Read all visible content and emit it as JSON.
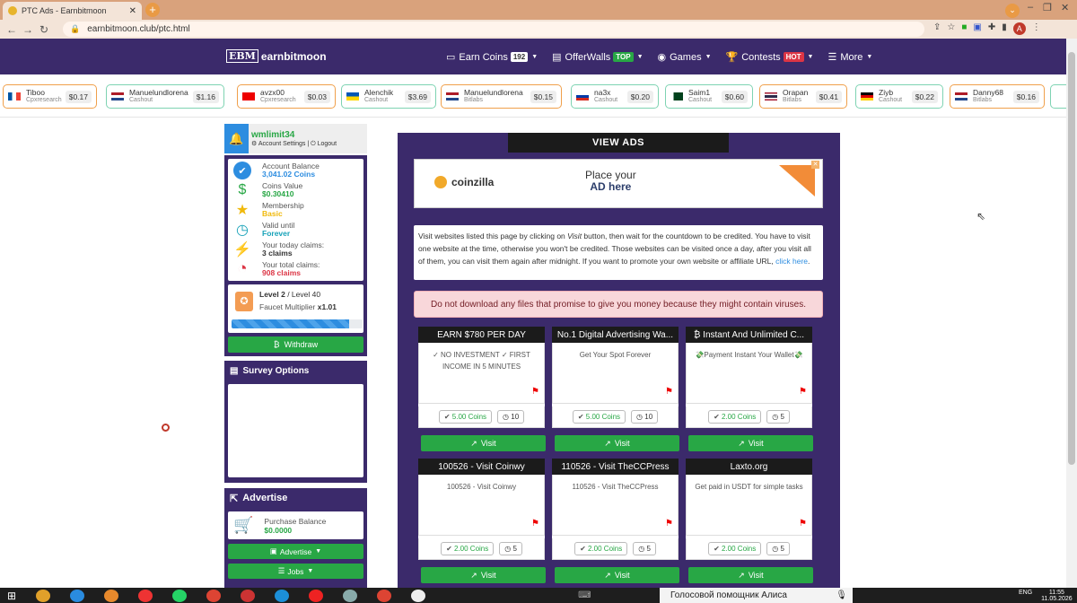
{
  "browser": {
    "tab_title": "PTC Ads - Earnbitmoon",
    "url": "earnbitmoon.club/ptc.html",
    "avatar_letter": "A"
  },
  "header": {
    "logo_mark": "EBM",
    "logo_text": "earnbitmoon",
    "nav": [
      {
        "label": "Earn Coins",
        "badge": "192"
      },
      {
        "label": "OfferWalls",
        "badge": "TOP"
      },
      {
        "label": "Games",
        "badge": ""
      },
      {
        "label": "Contests",
        "badge": "HOT"
      },
      {
        "label": "More",
        "badge": ""
      }
    ]
  },
  "ticker": [
    {
      "name": "Tiboo",
      "source": "Cpxresearch",
      "amount": "$0.17",
      "color": "#f0a04b",
      "flag": "fr"
    },
    {
      "name": "Manuelundlorena",
      "source": "Cashout",
      "amount": "$1.16",
      "color": "#7ed3b2",
      "flag": "nl"
    },
    {
      "name": "avzx00",
      "source": "Cpxresearch",
      "amount": "$0.03",
      "color": "#f0a04b",
      "flag": "yt"
    },
    {
      "name": "Alenchik",
      "source": "Cashout",
      "amount": "$3.69",
      "color": "#7ed3b2",
      "flag": "ua"
    },
    {
      "name": "Manuelundlorena",
      "source": "Bitlabs",
      "amount": "$0.15",
      "color": "#f0a04b",
      "flag": "nl"
    },
    {
      "name": "na3x",
      "source": "Cashout",
      "amount": "$0.20",
      "color": "#7ed3b2",
      "flag": "ru"
    },
    {
      "name": "Saim1",
      "source": "Cashout",
      "amount": "$0.60",
      "color": "#7ed3b2",
      "flag": "pk"
    },
    {
      "name": "Orapan",
      "source": "Bitlabs",
      "amount": "$0.41",
      "color": "#f0a04b",
      "flag": "th"
    },
    {
      "name": "Ziyb",
      "source": "Cashout",
      "amount": "$0.22",
      "color": "#7ed3b2",
      "flag": "de"
    },
    {
      "name": "Danny68",
      "source": "Bitlabs",
      "amount": "$0.16",
      "color": "#f0a04b",
      "flag": "nl"
    }
  ],
  "user": {
    "name": "wmlimit34",
    "account_settings": "Account Settings",
    "separator": "|",
    "logout": "Logout"
  },
  "stats": [
    {
      "label": "Account Balance",
      "value": "3,041.02 Coins",
      "color": "#2d8de0",
      "icon": "check-circle-icon"
    },
    {
      "label": "Coins Value",
      "value": "$0.30410",
      "color": "#28a745",
      "icon": "dollar-icon"
    },
    {
      "label": "Membership",
      "value": "Basic",
      "color": "#f0b90b",
      "icon": "star-icon"
    },
    {
      "label": "Valid until",
      "value": "Forever",
      "color": "#17a2b8",
      "icon": "clock-icon"
    },
    {
      "label": "Your today claims:",
      "value": "3 claims",
      "color": "#333333",
      "icon": "bolt-icon"
    },
    {
      "label": "Your total claims:",
      "value": "908 claims",
      "color": "#dc3545",
      "icon": "pie-chart-icon"
    }
  ],
  "level": {
    "text": "Level 2",
    "max": "/ Level 40",
    "multiplier_label": "Faucet Multiplier",
    "multiplier": "x1.01",
    "progress": 0.9
  },
  "withdraw_label": "Withdraw",
  "survey_title": "Survey Options",
  "advertise": {
    "title": "Advertise",
    "purchase_label": "Purchase Balance",
    "purchase_value": "$0.0000",
    "advertise_btn": "Advertise",
    "jobs_btn": "Jobs"
  },
  "main": {
    "title": "VIEW ADS",
    "banner_brand": "coinzilla",
    "banner_line1": "Place your",
    "banner_line2": "AD here",
    "info_text_1": "Visit websites listed this page by clicking on ",
    "info_visit": "Visit",
    "info_text_2": " button, then wait for the countdown to be credited. You have to visit one website at the time, otherwise you won't be credited. Those websites can be visited once a day, after you visit all of them, you can visit them again after midnight. If you want to promote your own website or affiliate URL, ",
    "info_link": "click here",
    "info_end": ".",
    "warning": "Do not download any files that promise to give you money because they might contain viruses."
  },
  "ads": [
    {
      "title": "EARN $780 PER DAY",
      "desc": "✓ NO INVESTMENT ✓ FIRST INCOME IN 5 MINUTES",
      "coins": "5.00 Coins",
      "time": "10",
      "visit": "Visit"
    },
    {
      "title": "No.1 Digital Advertising Wa...",
      "desc": "Get Your Spot Forever",
      "coins": "5.00 Coins",
      "time": "10",
      "visit": "Visit"
    },
    {
      "title": "₿ Instant And Unlimited C...",
      "desc": "💸Payment Instant Your Wallet💸",
      "coins": "2.00 Coins",
      "time": "5",
      "visit": "Visit"
    },
    {
      "title": "100526 - Visit Coinwy",
      "desc": "100526 - Visit Coinwy",
      "coins": "2.00 Coins",
      "time": "5",
      "visit": "Visit"
    },
    {
      "title": "110526 - Visit TheCCPress",
      "desc": "110526 - Visit TheCCPress",
      "coins": "2.00 Coins",
      "time": "5",
      "visit": "Visit"
    },
    {
      "title": "Laxto.org",
      "desc": "Get paid in USDT for simple tasks",
      "coins": "2.00 Coins",
      "time": "5",
      "visit": "Visit"
    }
  ],
  "taskbar": {
    "assistant": "Голосовой помощник Алиса",
    "lang": "ENG",
    "time": "11:55",
    "date": "11.05.2026"
  }
}
